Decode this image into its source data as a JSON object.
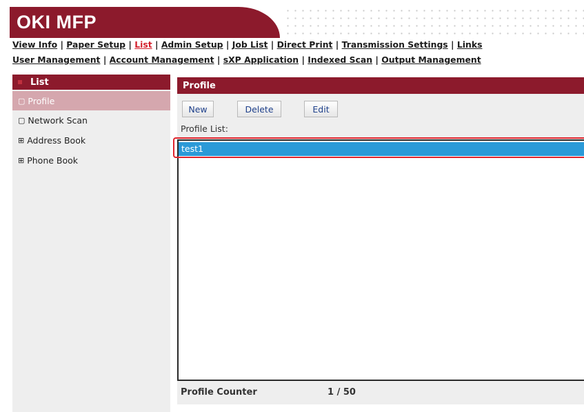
{
  "brand": {
    "title": "OKI MFP"
  },
  "nav": {
    "row1": [
      {
        "label": "View Info",
        "active": false
      },
      {
        "label": "Paper Setup",
        "active": false
      },
      {
        "label": "List",
        "active": true
      },
      {
        "label": "Admin Setup",
        "active": false
      },
      {
        "label": "Job List",
        "active": false
      },
      {
        "label": "Direct Print",
        "active": false
      },
      {
        "label": "Transmission Settings",
        "active": false
      },
      {
        "label": "Links",
        "active": false
      }
    ],
    "row2": [
      {
        "label": "User Management"
      },
      {
        "label": "Account Management"
      },
      {
        "label": "sXP Application"
      },
      {
        "label": "Indexed Scan"
      },
      {
        "label": "Output Management"
      }
    ]
  },
  "sidebar": {
    "title": "List",
    "items": [
      {
        "label": "Profile",
        "marker": "▢",
        "active": true
      },
      {
        "label": "Network Scan",
        "marker": "▢",
        "active": false
      },
      {
        "label": "Address Book",
        "marker": "⊞",
        "active": false
      },
      {
        "label": "Phone Book",
        "marker": "⊞",
        "active": false
      }
    ]
  },
  "main": {
    "title": "Profile",
    "buttons": {
      "new": "New",
      "delete": "Delete",
      "edit": "Edit"
    },
    "list_label": "Profile List:",
    "profiles": [
      "test1"
    ],
    "counter_label": "Profile Counter",
    "counter_value": "1 / 50"
  },
  "colors": {
    "brand": "#8c1a2c",
    "selection": "#2b9ad8",
    "highlight": "#e0242c",
    "active_link": "#d4202c"
  }
}
